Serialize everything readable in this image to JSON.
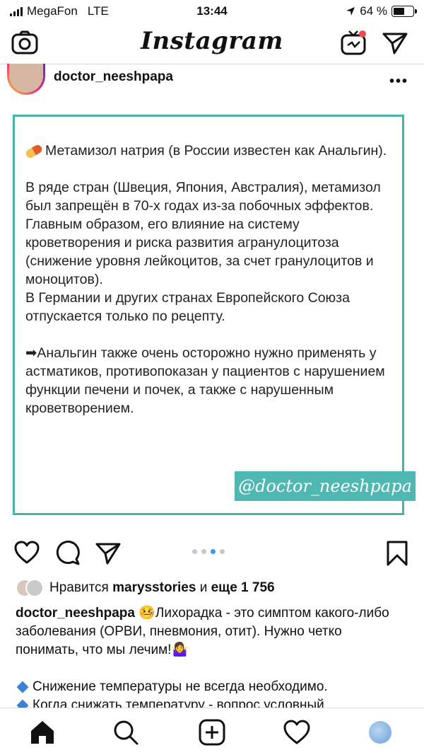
{
  "status_bar": {
    "carrier": "MegaFon",
    "network": "LTE",
    "time": "13:44",
    "battery_percent": "64 %",
    "battery_level": 0.64
  },
  "top_nav": {
    "logo": "Instagram",
    "icons": [
      "camera-icon",
      "igtv-icon",
      "direct-icon"
    ]
  },
  "post": {
    "username": "doctor_neeshpapa",
    "more": "•••",
    "image_text": {
      "para1": "Метамизол натрия (в России известен как Анальгин).",
      "para2": "В ряде стран (Швеция, Япония, Австралия), метамизол был запрещён в 70-х годах из-за побочных эффектов. Главным образом, его влияние на систему кроветворения и риска развития агранулоцитоза (снижение уровня лейкоцитов, за счет гранулоцитов и моноцитов).",
      "para3": "В Германии и других странах Европейского Союза отпускается только по рецепту.",
      "para4_prefix": "➡",
      "para4": "Анальгин также очень осторожно нужно применять у астматиков, противопоказан у пациентов с нарушением функции печени и почек, а также с нарушенным кроветворением.",
      "watermark": "@doctor_neeshpapa"
    },
    "carousel": {
      "count": 4,
      "active": 3
    },
    "likes": {
      "prefix": "Нравится",
      "user": "marysstories",
      "middle": "и",
      "more": "еще 1 756"
    },
    "caption": {
      "username": "doctor_neeshpapa",
      "emoji": "🤒",
      "text": "Лихорадка - это симптом какого-либо заболевания (ОРВИ, пневмония, отит). Нужно четко понимать, что мы лечим!🤷‍♀️",
      "bullet1": "Снижение температуры не всегда необходимо.",
      "bullet2": "Когда снижать температуру - вопрос условный"
    }
  },
  "tab_bar": {
    "items": [
      "home-icon",
      "search-icon",
      "new-post-icon",
      "activity-icon",
      "profile-icon"
    ]
  },
  "colors": {
    "frame": "#46b3ad",
    "watermark_bg": "#4fb8b2",
    "dot_active": "#3897f0"
  }
}
